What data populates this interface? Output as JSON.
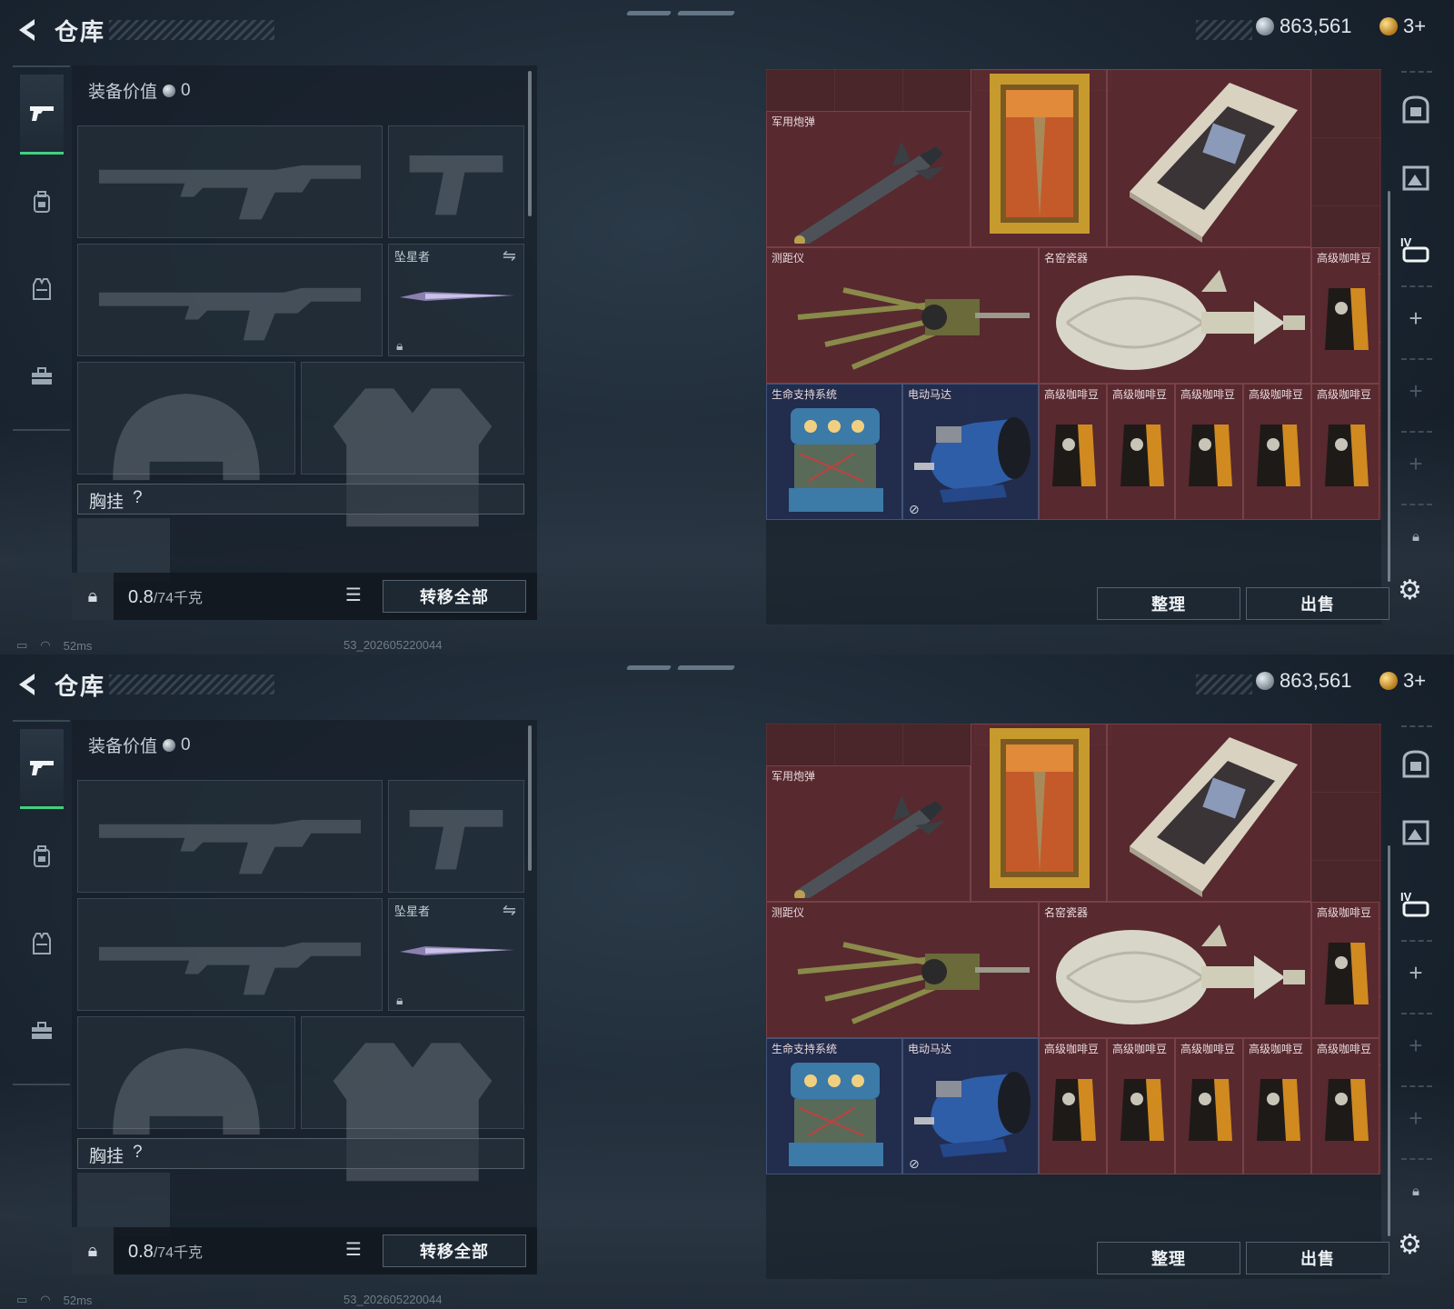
{
  "screens": [
    {
      "header": {
        "title": "仓库",
        "currency_silver": "863,561",
        "currency_gold": "3+"
      },
      "nav": {
        "items": [
          "pistol-icon",
          "backpack-icon",
          "vest-icon",
          "toolbox-icon"
        ]
      },
      "equipment": {
        "value_label": "装备价值",
        "value": "0",
        "melee_slot_label": "坠星者",
        "chest_rig_label": "胸挂",
        "chest_rig_help": "?",
        "weight_current": "0.8",
        "weight_max": "/74千克",
        "transfer_all_label": "转移全部"
      },
      "stash": {
        "items": [
          "军用炮弹",
          "测距仪",
          "名窑瓷器",
          "高级咖啡豆",
          "生命支持系统",
          "电动马达",
          "高级咖啡豆",
          "高级咖啡豆",
          "高级咖啡豆",
          "高级咖啡豆",
          "高级咖啡豆"
        ],
        "sort_label": "整理",
        "sell_label": "出售"
      },
      "status": {
        "ping": "52ms",
        "build": "53_202605220044"
      }
    },
    {
      "header": {
        "title": "仓库",
        "currency_silver": "863,561",
        "currency_gold": "3+"
      },
      "nav": {
        "items": [
          "pistol-icon",
          "backpack-icon",
          "vest-icon",
          "toolbox-icon"
        ]
      },
      "equipment": {
        "value_label": "装备价值",
        "value": "0",
        "melee_slot_label": "坠星者",
        "chest_rig_label": "胸挂",
        "chest_rig_help": "?",
        "weight_current": "0.8",
        "weight_max": "/74千克",
        "transfer_all_label": "转移全部"
      },
      "stash": {
        "items": [
          "军用炮弹",
          "测距仪",
          "名窑瓷器",
          "高级咖啡豆",
          "生命支持系统",
          "电动马达",
          "高级咖啡豆",
          "高级咖啡豆",
          "高级咖啡豆",
          "高级咖啡豆",
          "高级咖啡豆"
        ],
        "sort_label": "整理",
        "sell_label": "出售"
      },
      "status": {
        "ping": "52ms",
        "build": "53_202605220044"
      }
    }
  ],
  "colors": {
    "accent_green": "#3fd17f",
    "stash_red": "#4a2529",
    "panel_dark": "#161f28"
  }
}
